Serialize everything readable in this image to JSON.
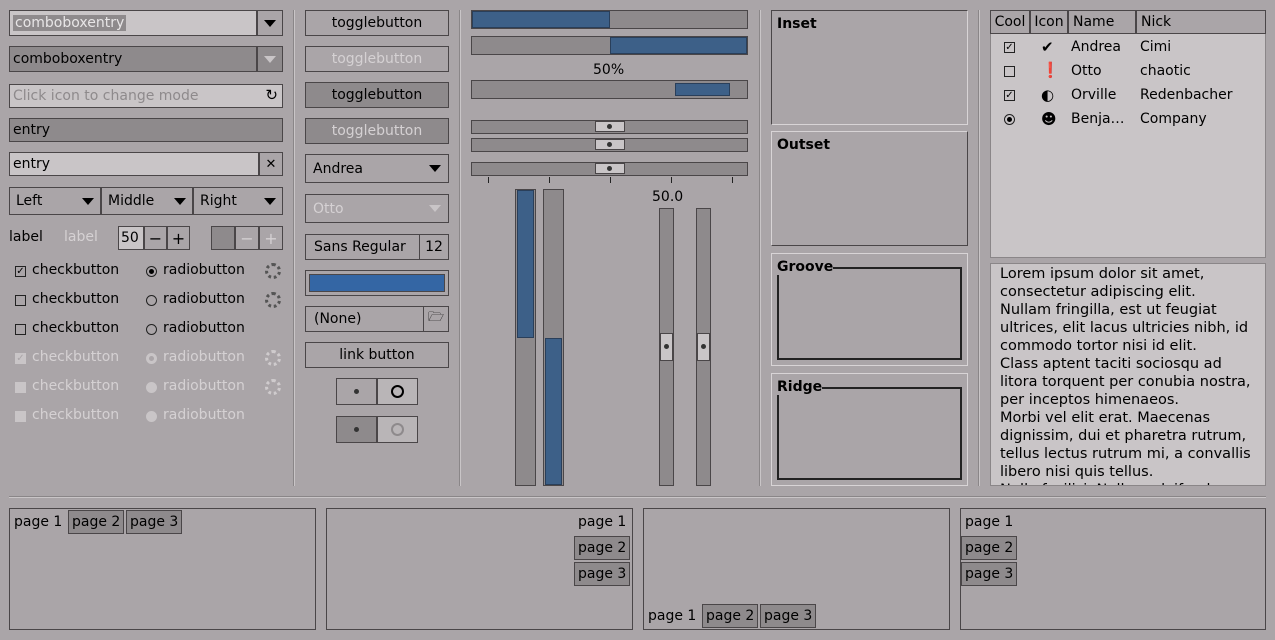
{
  "col1": {
    "combo1": "comboboxentry",
    "combo2": "comboboxentry",
    "entry_icon_placeholder": "Click icon to change mode",
    "entry_dark": "entry",
    "entry_clear": "entry",
    "segmented": [
      "Left",
      "Middle",
      "Right"
    ],
    "label1": "label",
    "label2": "label",
    "spin_value": "50",
    "checks": [
      {
        "label": "checkbutton",
        "checked": true
      },
      {
        "label": "checkbutton",
        "checked": false
      },
      {
        "label": "checkbutton",
        "checked": false
      },
      {
        "label": "checkbutton",
        "checked": true
      },
      {
        "label": "checkbutton",
        "checked": false
      },
      {
        "label": "checkbutton",
        "checked": false
      }
    ],
    "radios": [
      {
        "label": "radiobutton",
        "checked": true
      },
      {
        "label": "radiobutton",
        "checked": false
      },
      {
        "label": "radiobutton",
        "checked": false
      },
      {
        "label": "radiobutton",
        "checked": true
      },
      {
        "label": "radiobutton",
        "checked": false
      },
      {
        "label": "radiobutton",
        "checked": false
      }
    ]
  },
  "col2": {
    "toggles": [
      "togglebutton",
      "togglebutton",
      "togglebutton",
      "togglebutton"
    ],
    "combo_andrea": "Andrea",
    "combo_otto": "Otto",
    "font_name": "Sans Regular",
    "font_size": "12",
    "file_none": "(None)",
    "link": "link button",
    "color_swatch": "#3466a4"
  },
  "col3": {
    "progress1": 0.5,
    "progress2": 0.5,
    "progress_text": "50%",
    "progress3": 0.2,
    "scale_value_text": "50.0",
    "scales": [
      0.5,
      0.5,
      0.5
    ],
    "vbar1": 0.5,
    "vbar2": 0.5,
    "vscale1": 0.5,
    "vscale2": 0.5
  },
  "col4": {
    "frames": [
      "Inset",
      "Outset",
      "Groove",
      "Ridge"
    ]
  },
  "col5": {
    "columns": [
      "Cool",
      "Icon",
      "Name",
      "Nick"
    ],
    "rows": [
      {
        "cool": "check",
        "icon": "check-circle-icon",
        "name": "Andrea",
        "nick": "Cimi"
      },
      {
        "cool": "empty",
        "icon": "warning-circle-icon",
        "name": "Otto",
        "nick": "chaotic"
      },
      {
        "cool": "check",
        "icon": "half-moon-icon",
        "name": "Orville",
        "nick": "Redenbacher"
      },
      {
        "cool": "radio",
        "icon": "person-icon",
        "name": "Benja…",
        "nick": "Company"
      }
    ],
    "text": "Lorem ipsum dolor sit amet, consectetur adipiscing elit.\nNullam fringilla, est ut feugiat ultrices, elit lacus ultricies nibh, id commodo tortor nisi id elit.\nClass aptent taciti sociosqu ad litora torquent per conubia nostra, per inceptos himenaeos.\nMorbi vel elit erat. Maecenas dignissim, dui et pharetra rutrum, tellus lectus rutrum mi, a convallis libero nisi quis tellus.\nNulla facilisi. Nullam eleifend"
  },
  "notebooks": [
    [
      "page 1",
      "page 2",
      "page 3"
    ],
    [
      "page 1",
      "page 2",
      "page 3"
    ],
    [
      "page 1",
      "page 2",
      "page 3"
    ],
    [
      "page 1",
      "page 2",
      "page 3"
    ]
  ]
}
